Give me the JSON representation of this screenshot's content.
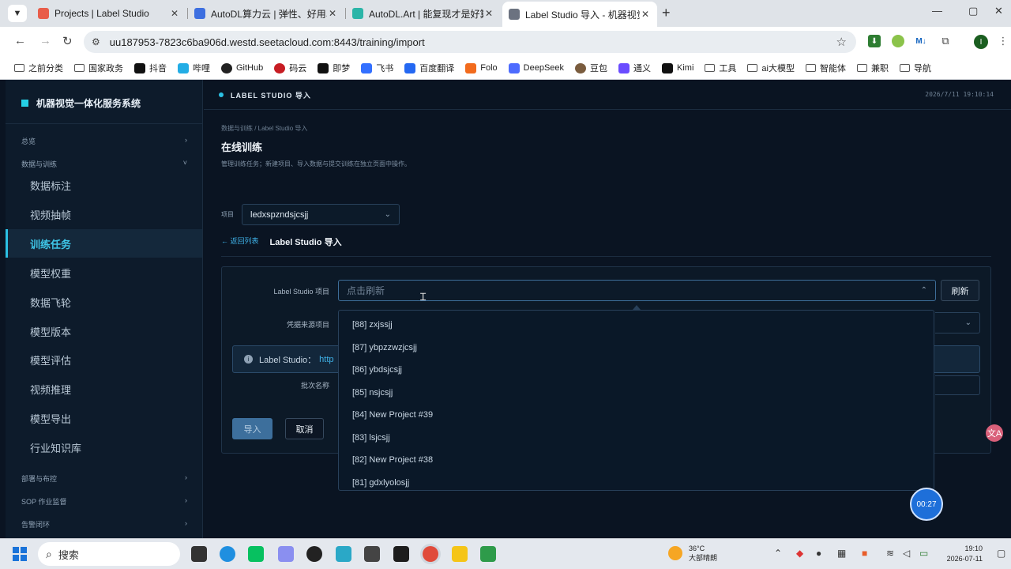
{
  "browser": {
    "tabs": [
      {
        "title": "Projects | Label Studio",
        "color": "#e85d4a"
      },
      {
        "title": "AutoDL算力云 | 弹性、好用、",
        "color": "#3d6fe0"
      },
      {
        "title": "AutoDL.Art | 能复现才是好算",
        "color": "#2bb5a8"
      },
      {
        "title": "Label Studio 导入 - 机器视觉",
        "color": "#6b7280"
      }
    ],
    "url": "uu187953-7823c6ba906d.westd.seetacloud.com:8443/training/import",
    "bookmarks": [
      "之前分类",
      "国家政务",
      "抖音",
      "哔哩",
      "GitHub",
      "码云",
      "即梦",
      "飞书",
      "百度翻译",
      "Folo",
      "DeepSeek",
      "豆包",
      "通义",
      "Kimi",
      "工具",
      "ai大模型",
      "智能体",
      "兼职",
      "导航"
    ],
    "extensions": [
      "M↓"
    ]
  },
  "sidebar": {
    "title": "机器视觉一体化服务系统",
    "group_overview": "总览",
    "group_data": "数据与训练",
    "items": [
      "数据标注",
      "视频抽帧",
      "训练任务",
      "模型权重",
      "数据飞轮",
      "模型版本",
      "模型评估",
      "视频推理",
      "模型导出",
      "行业知识库"
    ],
    "group_deploy": "部署与布控",
    "group_sop": "SOP 作业监督",
    "group_alert": "告警闭环",
    "chev": "›",
    "chev_open": "˅"
  },
  "topbar": {
    "title": "LABEL STUDIO 导入",
    "datetime": "2026/7/11 19:10:14"
  },
  "main": {
    "breadcrumb": "数据与训练 / Label Studio 导入",
    "title": "在线训练",
    "subtitle": "管理训练任务；新建项目、导入数据与提交训练在独立页面中操作。",
    "project_label": "项目",
    "project_value": "ledxspzndsjcsjj",
    "back_link": "← 返回列表",
    "current_tab": "Label Studio 导入",
    "form": {
      "ls_project_label": "Label Studio 项目",
      "ls_project_placeholder": "点击刷新",
      "refresh": "刷新",
      "credential_label": "凭据来源项目",
      "info_text": "Label Studio：",
      "info_link": "http",
      "batch_label": "批次名称",
      "import": "导入",
      "cancel": "取消"
    }
  },
  "dropdown": {
    "options": [
      "[88] zxjssjj",
      "[87] ybpzzwzjcsjj",
      "[86] ybdsjcsjj",
      "[85] nsjcsjj",
      "[84] New Project #39",
      "[83] lsjcsjj",
      "[82] New Project #38",
      "[81] gdxlyolosjj"
    ]
  },
  "overlay": {
    "timer": "00:27",
    "translate_icon": "文A"
  },
  "taskbar": {
    "search": "搜索",
    "weather_temp": "36°C",
    "weather_desc": "大部晴朗",
    "time": "19:10",
    "date": "2026-07-11"
  }
}
